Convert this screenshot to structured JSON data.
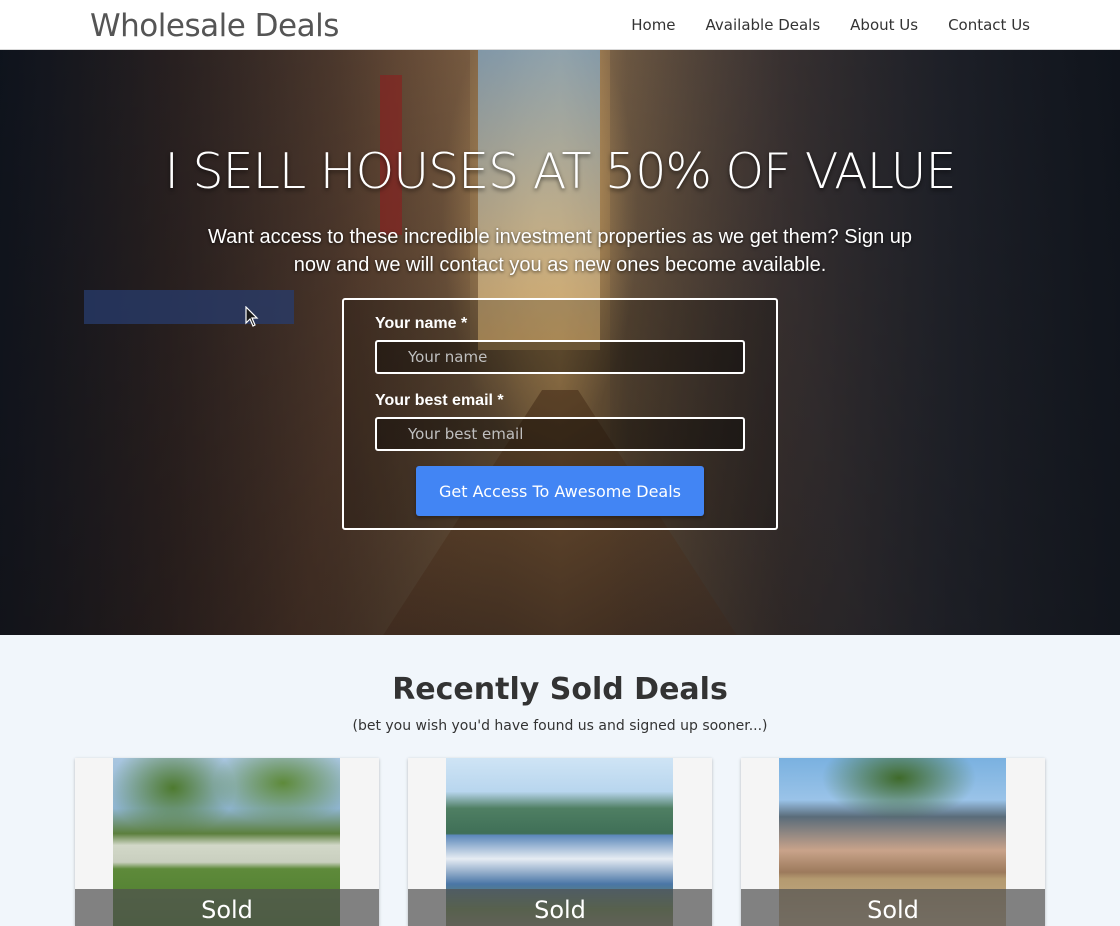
{
  "navbar": {
    "brand": "Wholesale Deals",
    "links": [
      "Home",
      "Available Deals",
      "About Us",
      "Contact Us"
    ]
  },
  "hero": {
    "title": "I SELL HOUSES AT 50% OF VALUE",
    "subtitle": "Want access to these incredible investment properties as we get them? Sign up now and we will contact you as new ones become available.",
    "form": {
      "name_label": "Your name *",
      "name_placeholder": "Your name",
      "email_label": "Your best email *",
      "email_placeholder": "Your best email",
      "submit_label": "Get Access To Awesome Deals"
    }
  },
  "sold": {
    "title": "Recently Sold Deals",
    "subtitle": "(bet you wish you'd have found us and signed up sooner...)",
    "cards": [
      {
        "status": "Sold"
      },
      {
        "status": "Sold"
      },
      {
        "status": "Sold"
      }
    ]
  },
  "colors": {
    "accent": "#4285f4",
    "section_bg": "#f1f6fb"
  }
}
